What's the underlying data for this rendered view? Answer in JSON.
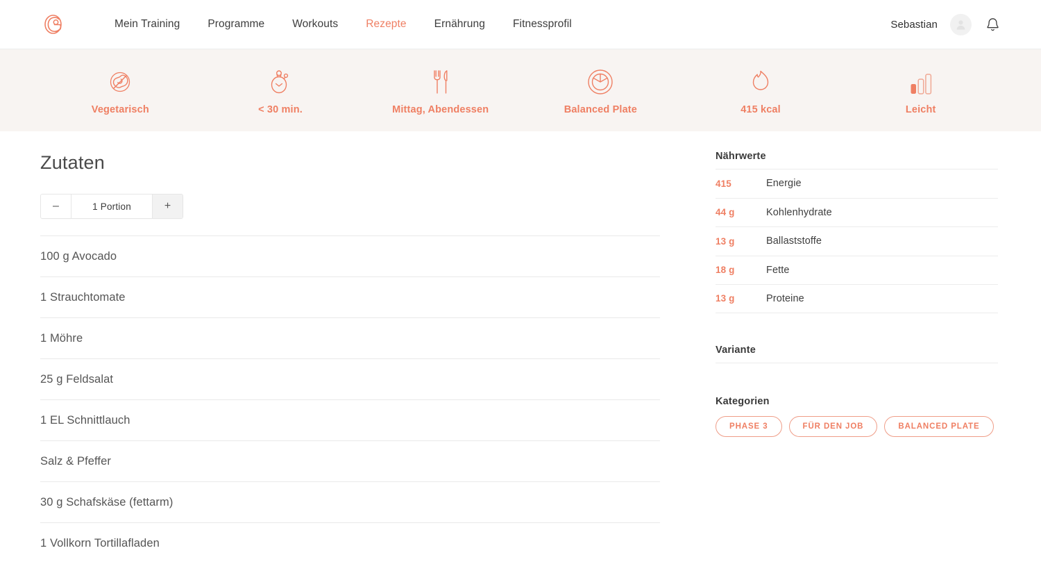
{
  "header": {
    "logo_icon": "brand-g-logo",
    "nav": [
      {
        "label": "Mein Training",
        "active": false
      },
      {
        "label": "Programme",
        "active": false
      },
      {
        "label": "Workouts",
        "active": false
      },
      {
        "label": "Rezepte",
        "active": true
      },
      {
        "label": "Ernährung",
        "active": false
      },
      {
        "label": "Fitnessprofil",
        "active": false
      }
    ],
    "user_name": "Sebastian",
    "avatar_icon": "user-avatar-icon",
    "bell_icon": "notification-bell-icon"
  },
  "attributes": [
    {
      "label": "Vegetarisch",
      "icon": "no-meat-icon"
    },
    {
      "label": "< 30 min.",
      "icon": "stopwatch-icon"
    },
    {
      "label": "Mittag, Abendessen",
      "icon": "fork-knife-icon"
    },
    {
      "label": "Balanced Plate",
      "icon": "balanced-plate-icon"
    },
    {
      "label": "415 kcal",
      "icon": "flame-icon"
    },
    {
      "label": "Leicht",
      "icon": "difficulty-bars-icon"
    }
  ],
  "ingredients_section": {
    "title": "Zutaten",
    "stepper": {
      "minus_label": "–",
      "plus_label": "+",
      "value": "1 Portion"
    },
    "items": [
      "100 g Avocado",
      "1 Strauchtomate",
      "1 Möhre",
      "25 g Feldsalat",
      "1 EL Schnittlauch",
      "Salz & Pfeffer",
      "30 g Schafskäse (fettarm)",
      "1 Vollkorn Tortillafladen"
    ]
  },
  "sidebar": {
    "nutrition": {
      "title": "Nährwerte",
      "rows": [
        {
          "value": "415",
          "name": "Energie"
        },
        {
          "value": "44 g",
          "name": "Kohlenhydrate"
        },
        {
          "value": "13 g",
          "name": "Ballaststoffe"
        },
        {
          "value": "18 g",
          "name": "Fette"
        },
        {
          "value": "13 g",
          "name": "Proteine"
        }
      ]
    },
    "variante": {
      "title": "Variante"
    },
    "kategorien": {
      "title": "Kategorien",
      "pills": [
        "PHASE 3",
        "FÜR DEN JOB",
        "BALANCED PLATE"
      ]
    }
  },
  "colors": {
    "accent": "#ef7f63",
    "attrbar_bg": "#f8f4f2",
    "text_dark": "#3c3c3c",
    "text_body": "#555555",
    "divider": "#e9e9e9"
  }
}
